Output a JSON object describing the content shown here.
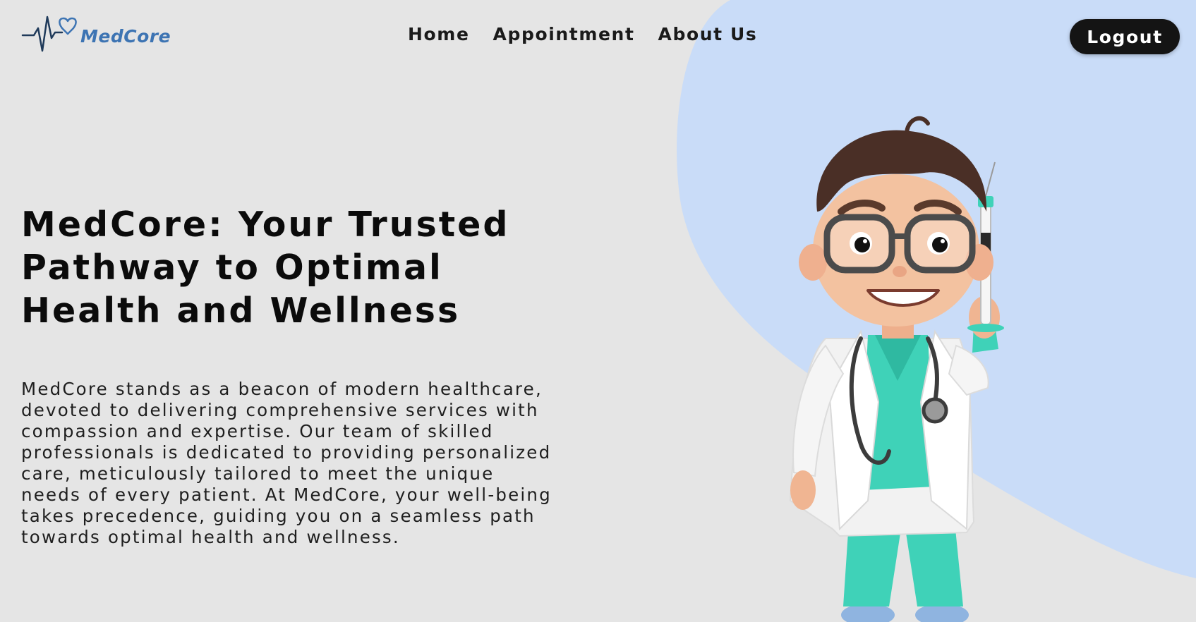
{
  "brand": {
    "name": "MedCore",
    "logo_icon": "heartbeat-heart-icon",
    "color": "#3d74b3"
  },
  "nav": {
    "items": [
      {
        "label": "Home"
      },
      {
        "label": "Appointment"
      },
      {
        "label": "About Us"
      }
    ]
  },
  "header": {
    "logout_label": "Logout"
  },
  "hero": {
    "title_lines": [
      "MedCore: Your Trusted",
      "Pathway to Optimal",
      "Health and Wellness"
    ],
    "description_lines": [
      "MedCore stands as a beacon of modern healthcare,",
      "devoted to delivering comprehensive services with",
      "compassion and expertise. Our team of skilled",
      "professionals is dedicated to providing personalized",
      "care, meticulously tailored to meet the unique",
      "needs of every patient. At MedCore, your well-being",
      "takes precedence, guiding you on a seamless path",
      "towards optimal health and wellness."
    ],
    "illustration": "cartoon-doctor-with-syringe"
  },
  "colors": {
    "background": "#e5e5e5",
    "accent_blob": "#c9dcf8",
    "button": "#141414",
    "scrubs": "#3fd2b8"
  }
}
